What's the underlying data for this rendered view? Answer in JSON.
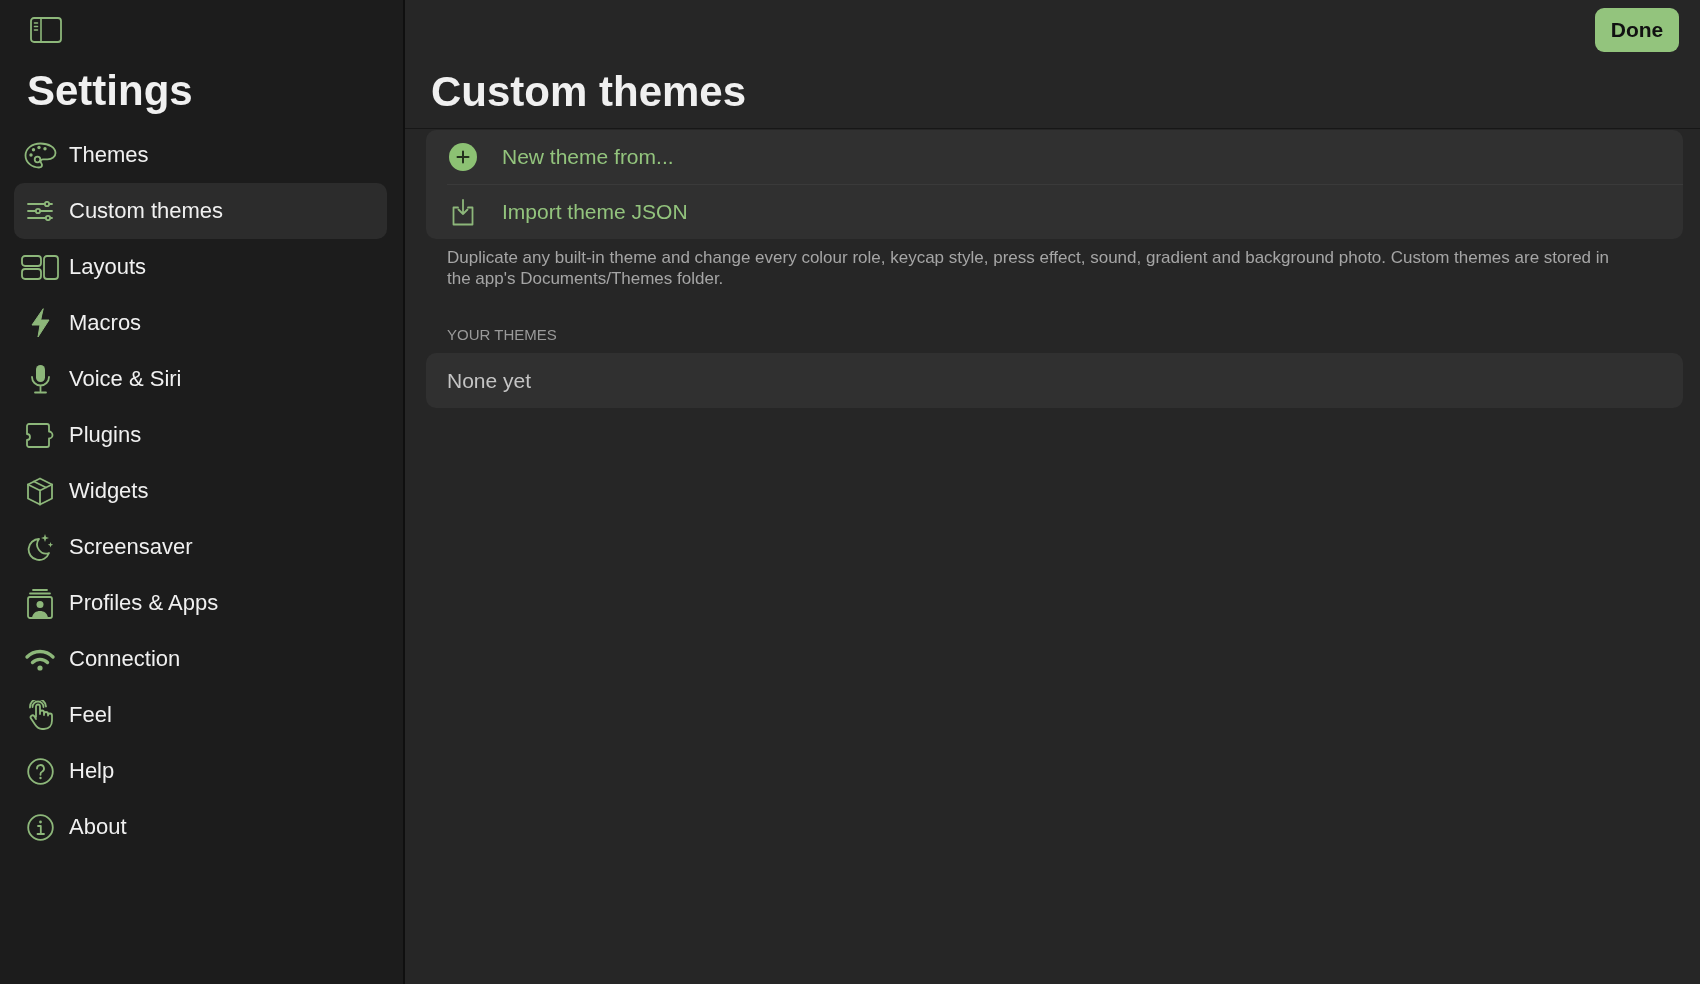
{
  "sidebar": {
    "title": "Settings",
    "items": [
      {
        "label": "Themes",
        "selected": false
      },
      {
        "label": "Custom themes",
        "selected": true
      },
      {
        "label": "Layouts",
        "selected": false
      },
      {
        "label": "Macros",
        "selected": false
      },
      {
        "label": "Voice & Siri",
        "selected": false
      },
      {
        "label": "Plugins",
        "selected": false
      },
      {
        "label": "Widgets",
        "selected": false
      },
      {
        "label": "Screensaver",
        "selected": false
      },
      {
        "label": "Profiles & Apps",
        "selected": false
      },
      {
        "label": "Connection",
        "selected": false
      },
      {
        "label": "Feel",
        "selected": false
      },
      {
        "label": "Help",
        "selected": false
      },
      {
        "label": "About",
        "selected": false
      }
    ]
  },
  "header": {
    "title": "Custom themes",
    "done_button": "Done"
  },
  "actions": [
    {
      "label": "New theme from..."
    },
    {
      "label": "Import theme JSON"
    }
  ],
  "description": "Duplicate any built-in theme and change every colour role, keycap style, press effect, sound, gradient and background photo. Custom themes are stored in the app's Documents/Themes folder.",
  "your_themes": {
    "heading": "YOUR THEMES",
    "empty_text": "None yet"
  }
}
